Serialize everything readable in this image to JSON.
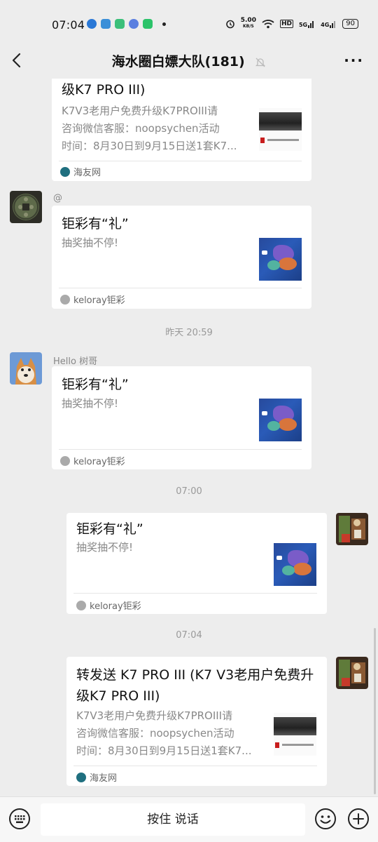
{
  "status_bar": {
    "time": "07:04",
    "net_speed": "5.00",
    "net_speed_unit": "KB/S",
    "hd_label": "HD",
    "signal1_label": "5G",
    "signal2_label": "4G",
    "battery": "90"
  },
  "nav": {
    "title": "海水圈白嫖大队(181)"
  },
  "messages": {
    "m1": {
      "title": "级K7 PRO III)",
      "desc_lines": [
        "K7V3老用户免费升级K7PROIII请",
        "咨询微信客服：noopsychen活动",
        "时间：8月30日到9月15日送1套K7..."
      ],
      "source": "海友网"
    },
    "m2": {
      "sender": "@",
      "title": "钜彩有“礼”",
      "desc": "抽奖抽不停!",
      "source": "keloray钜彩"
    },
    "ts1": "昨天 20:59",
    "m3": {
      "sender": "Hello   树哥",
      "title": "钜彩有“礼”",
      "desc": "抽奖抽不停!",
      "source": "keloray钜彩"
    },
    "ts2": "07:00",
    "m4": {
      "title": "钜彩有“礼”",
      "desc": "抽奖抽不停!",
      "source": "keloray钜彩"
    },
    "ts3": "07:04",
    "m5": {
      "title_lines": [
        "转发送 K7 PRO III (K7 V3老用户免费升",
        "级K7 PRO III)"
      ],
      "desc_lines": [
        "K7V3老用户免费升级K7PROIII请",
        "咨询微信客服：noopsychen活动",
        "时间：8月30日到9月15日送1套K7..."
      ],
      "source": "海友网"
    }
  },
  "input_bar": {
    "voice_label": "按住 说话"
  },
  "icons": {
    "back": "back-arrow-icon",
    "mute": "bell-muted-icon",
    "more": "more-dots-icon",
    "keyboard": "keyboard-icon",
    "emoji": "emoji-icon",
    "plus": "plus-icon"
  }
}
